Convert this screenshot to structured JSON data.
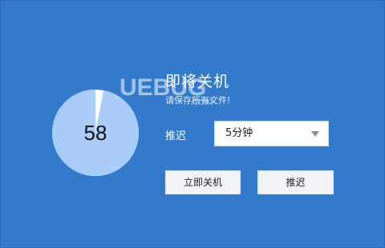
{
  "dialog": {
    "title": "即将关机",
    "subtitle": "请保存所有文件!",
    "background_color": "#3379cc"
  },
  "countdown": {
    "seconds": "58",
    "remaining_fraction": 0.97,
    "fill_color": "#a9cdf8",
    "track_color": "#ffffff"
  },
  "delay": {
    "label": "推迟",
    "selected_option": "5分钟",
    "arrow_icon": "chevron-down-icon"
  },
  "buttons": {
    "shutdown_label": "立即关机",
    "delay_label": "推迟"
  },
  "watermark": {
    "text": "UEBUG",
    "domain": ".com"
  }
}
